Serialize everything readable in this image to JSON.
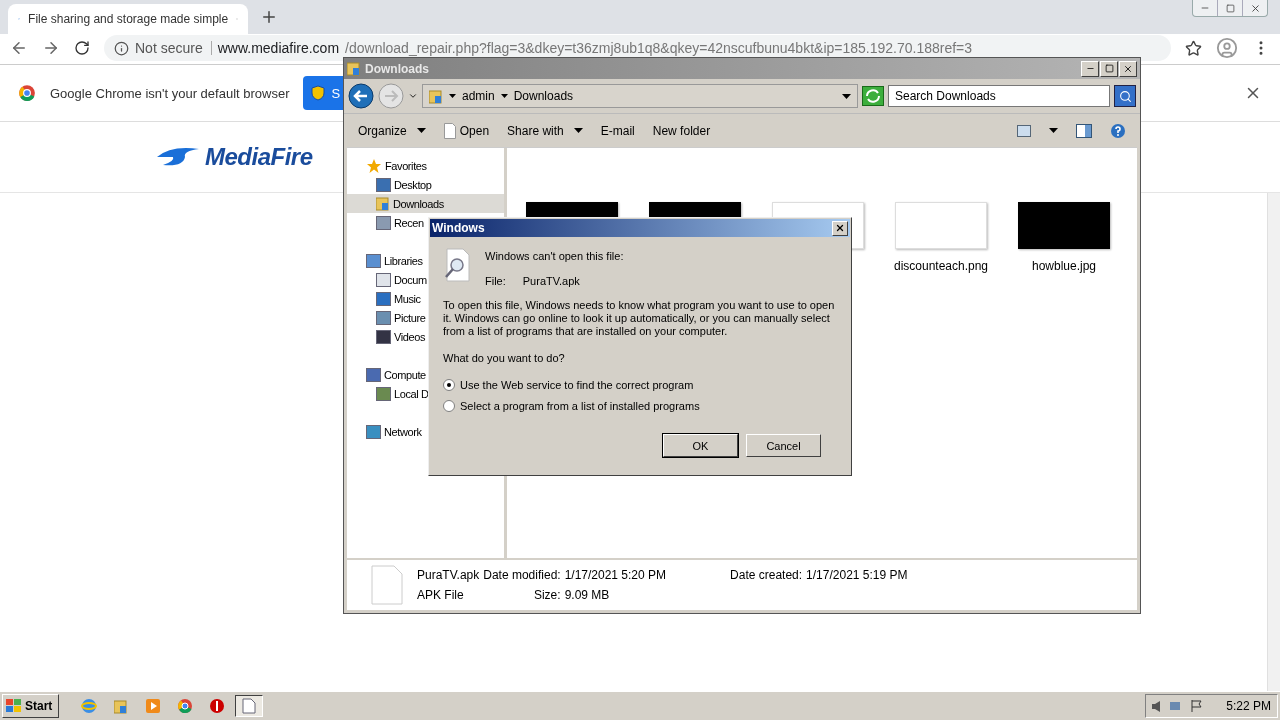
{
  "browser": {
    "tab": {
      "title": "File sharing and storage made simple",
      "selected": true
    },
    "address": {
      "security": "Not secure",
      "host": "www.mediafire.com",
      "path": "/download_repair.php?flag=3&dkey=t36zmj8ub1q8&qkey=42nscufbunu4bkt&ip=185.192.70.188ref=3"
    },
    "infobar": {
      "message": "Google Chrome isn't your default browser",
      "button": "S"
    }
  },
  "page": {
    "logo": "MediaFire"
  },
  "explorer": {
    "title": "Downloads",
    "breadcrumb": [
      "admin",
      "Downloads"
    ],
    "search": {
      "placeholder": "Search Downloads"
    },
    "toolbar": [
      {
        "label": "Organize",
        "menu": true,
        "kind": "plain"
      },
      {
        "label": "Open",
        "menu": false,
        "kind": "file"
      },
      {
        "label": "Share with",
        "menu": true,
        "kind": "plain"
      },
      {
        "label": "E-mail",
        "menu": false,
        "kind": "plain"
      },
      {
        "label": "New folder",
        "menu": false,
        "kind": "plain"
      }
    ],
    "sidebar": [
      {
        "label": "Favorites",
        "selected": false,
        "children": [
          {
            "label": "Desktop",
            "selected": false
          },
          {
            "label": "Downloads",
            "selected": true
          },
          {
            "label": "Recen",
            "selected": false
          }
        ]
      },
      {
        "label": "Libraries",
        "selected": false,
        "children": [
          {
            "label": "Docum",
            "selected": false
          },
          {
            "label": "Music",
            "selected": false
          },
          {
            "label": "Picture",
            "selected": false
          },
          {
            "label": "Videos",
            "selected": false
          }
        ]
      },
      {
        "label": "Compute",
        "selected": false,
        "children": [
          {
            "label": "Local D",
            "selected": false
          }
        ]
      },
      {
        "label": "Network",
        "selected": false
      }
    ],
    "files": [
      {
        "kind": "dark"
      },
      {
        "kind": "dark"
      },
      {
        "kind": "light"
      },
      {
        "kind": "light",
        "name": "discounteach.png"
      },
      {
        "kind": "dark",
        "name": "howblue.jpg"
      }
    ],
    "details": {
      "name": "PuraTV.apk",
      "type": "APK File",
      "fields": [
        {
          "label": "Date modified:",
          "value": "1/17/2021 5:20 PM"
        },
        {
          "label": "Size:",
          "value": "9.09 MB"
        },
        {
          "label": "Date created:",
          "value": "1/17/2021 5:19 PM"
        }
      ]
    }
  },
  "dialog": {
    "title": "Windows",
    "heading": "Windows can't open this file:",
    "file_label": "File:",
    "file_name": "PuraTV.apk",
    "body": "To open this file, Windows needs to know what program you want to use to open it. Windows can go online to look it up automatically, or you can manually select from a list of programs that are installed on your computer.",
    "question": "What do you want to do?",
    "options": [
      {
        "label": "Use the Web service to find the correct program",
        "selected": true
      },
      {
        "label": "Select a program from a list of installed programs",
        "selected": false
      }
    ],
    "buttons": [
      {
        "label": "OK",
        "default": true
      },
      {
        "label": "Cancel",
        "default": false
      }
    ]
  },
  "taskbar": {
    "start": "Start",
    "apps": [
      {
        "kind": "ie",
        "selected": false
      },
      {
        "kind": "folder",
        "selected": false
      },
      {
        "kind": "media",
        "selected": false
      },
      {
        "kind": "chrome",
        "selected": false
      },
      {
        "kind": "stop",
        "selected": false
      },
      {
        "kind": "document",
        "selected": true
      }
    ],
    "clock": "5:22 PM"
  }
}
